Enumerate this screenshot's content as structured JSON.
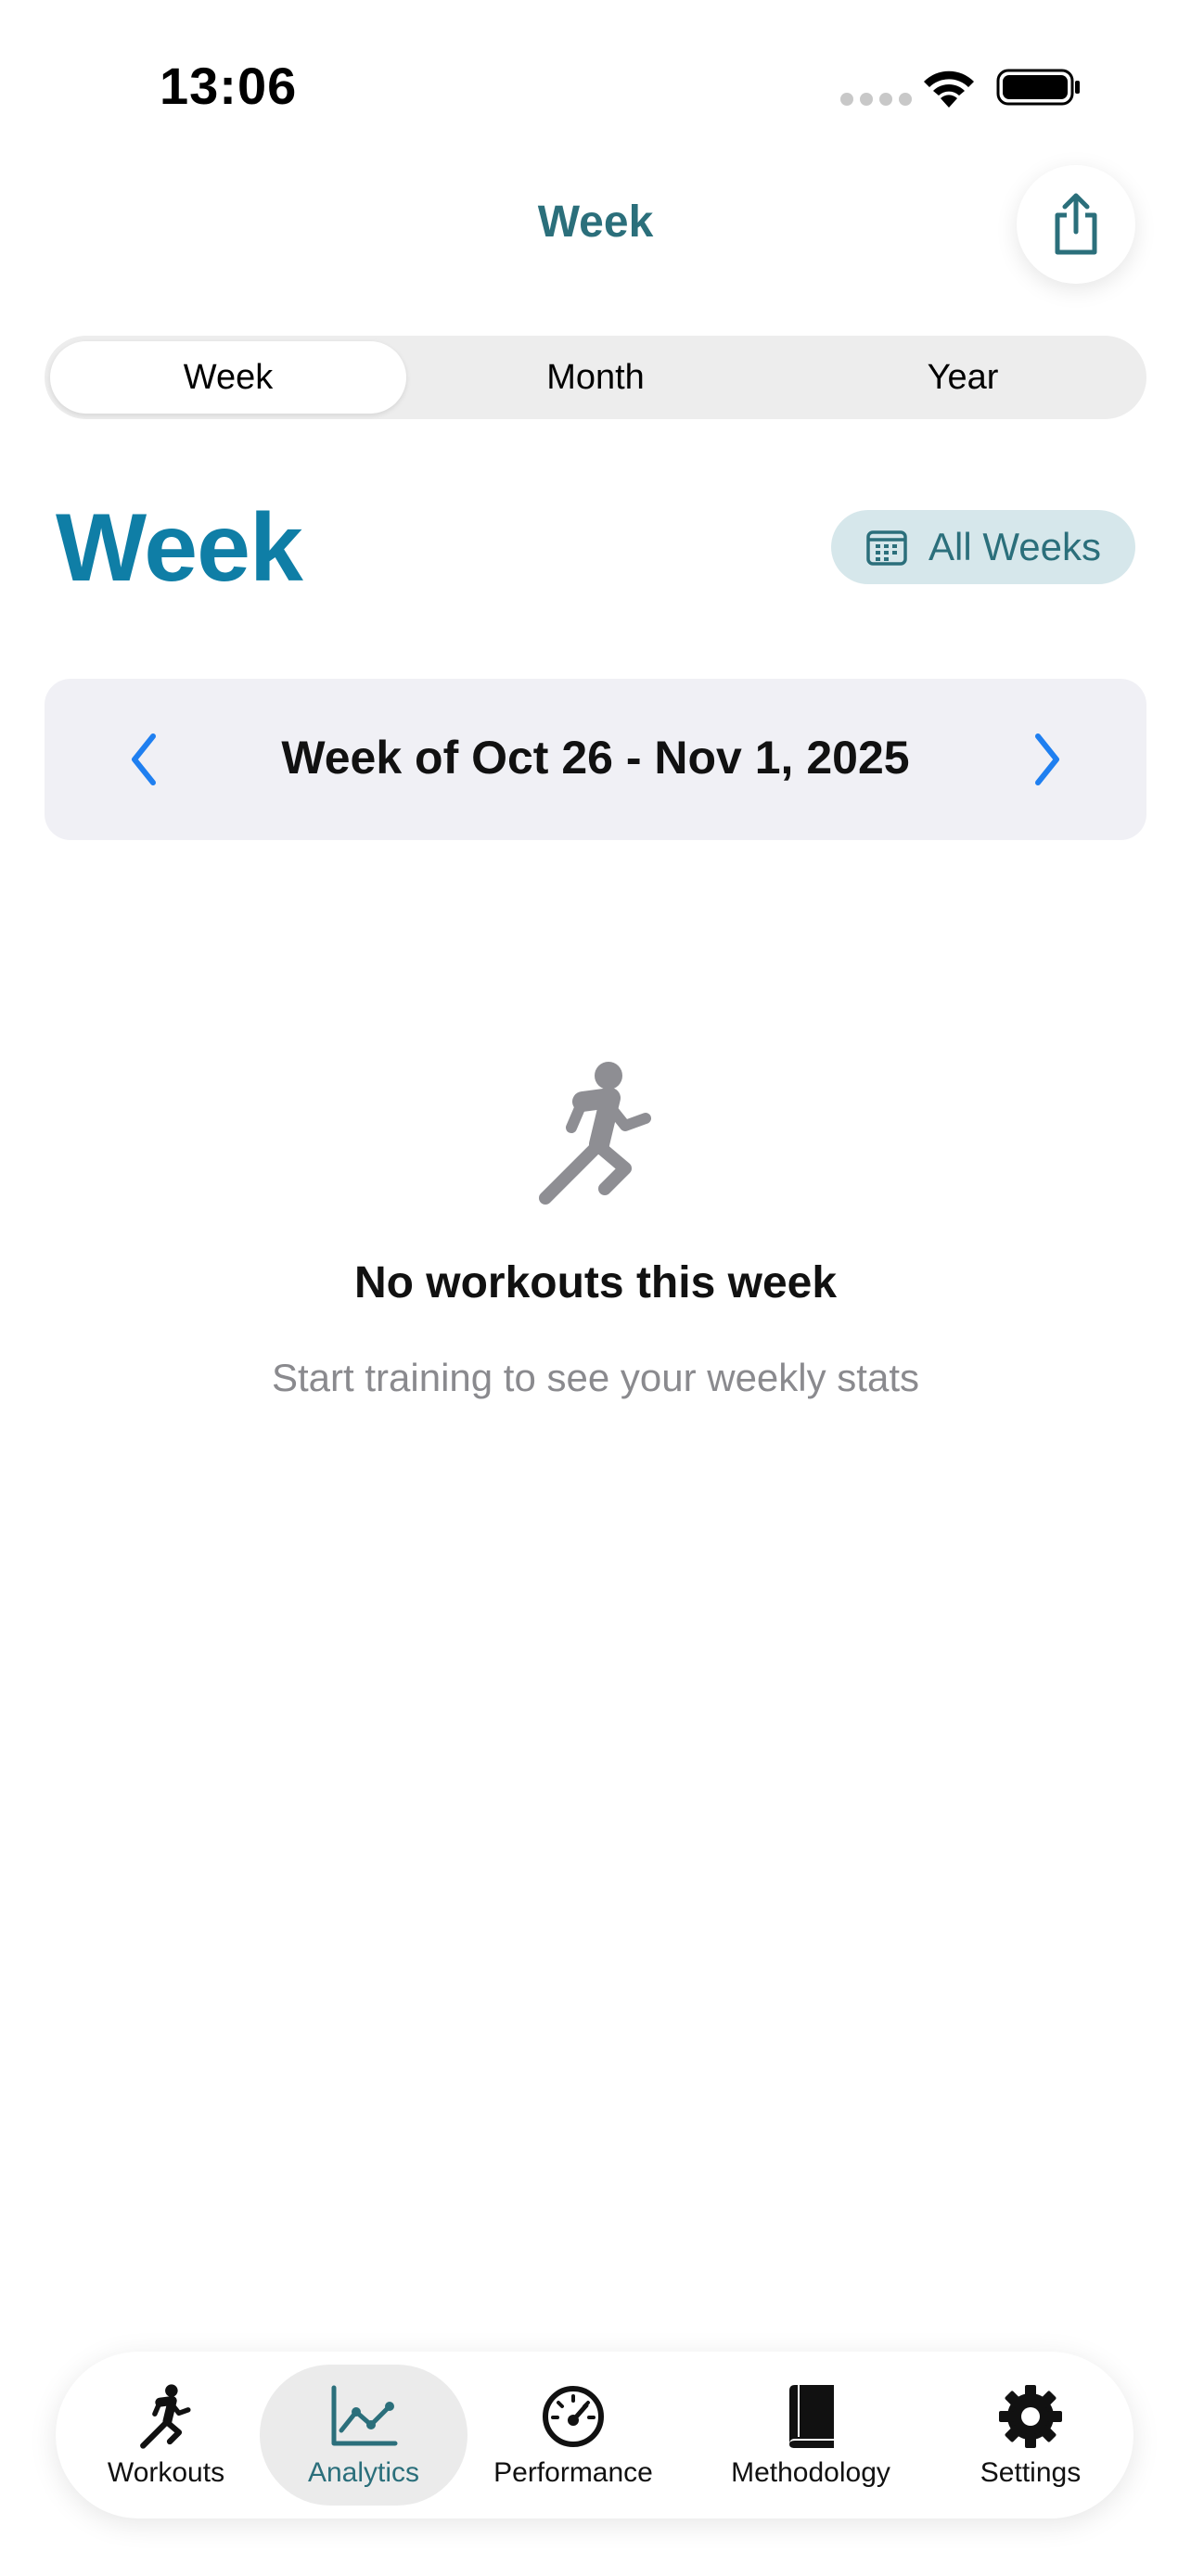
{
  "status_bar": {
    "time": "13:06"
  },
  "nav": {
    "title": "Week",
    "share_icon": "share-icon"
  },
  "segments": [
    {
      "label": "Week",
      "selected": true
    },
    {
      "label": "Month",
      "selected": false
    },
    {
      "label": "Year",
      "selected": false
    }
  ],
  "page": {
    "title": "Week",
    "all_weeks_label": "All Weeks",
    "all_weeks_icon": "calendar-icon"
  },
  "week_nav": {
    "label": "Week of Oct 26 - Nov 1, 2025"
  },
  "empty_state": {
    "icon": "running-figure-icon",
    "title": "No workouts this week",
    "subtitle": "Start training to see your weekly stats"
  },
  "tab_bar": {
    "items": [
      {
        "label": "Workouts",
        "icon": "running-figure-icon",
        "selected": false
      },
      {
        "label": "Analytics",
        "icon": "line-chart-icon",
        "selected": true
      },
      {
        "label": "Performance",
        "icon": "gauge-icon",
        "selected": false
      },
      {
        "label": "Methodology",
        "icon": "book-icon",
        "selected": false
      },
      {
        "label": "Settings",
        "icon": "gear-icon",
        "selected": false
      }
    ]
  },
  "colors": {
    "accent": "#2b6f7b",
    "title_blue": "#0f7ea6",
    "chevron_blue": "#1f7ff0",
    "muted_text": "#8a8a8e"
  }
}
